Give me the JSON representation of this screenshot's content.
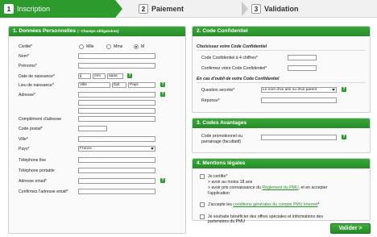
{
  "steps": [
    {
      "num": "1",
      "label": "Inscription"
    },
    {
      "num": "2",
      "label": "Paiement"
    },
    {
      "num": "3",
      "label": "Validation"
    }
  ],
  "personal": {
    "title": "1. Données Personnelles",
    "subtitle_open": "(",
    "subtitle_star": "*",
    "subtitle_text": " Champs obligatoires)",
    "civilite_label": "Civilité*",
    "civilite_options": [
      "Mlle",
      "Mme",
      "M"
    ],
    "nom_label": "Nom*",
    "prenoms_label": "Prénoms*",
    "dob_label": "Date de naissance*",
    "dob_jj": "jj",
    "dob_mm": "mm",
    "dob_aaaa": "aaaa",
    "lieu_label": "Lieu de naissance*",
    "lieu_ville": "Ville",
    "lieu_dpt": "Dpt",
    "lieu_pays": "Pays",
    "adresse_label": "Adresse*",
    "complement_label": "Complément d'adresse",
    "cp_label": "Code postal*",
    "ville_label": "Ville*",
    "pays_label": "Pays*",
    "pays_value": "France",
    "tel_fixe_label": "Téléphone fixe",
    "tel_port_label": "Téléphone portable",
    "email_label": "Adresse email*",
    "email_confirm_label": "Confirmez l'adresse email*",
    "help": "?"
  },
  "code": {
    "title": "2. Code Confidentiel",
    "choose_heading": "Choisissez votre Code Confidentiel",
    "code_label": "Code Confidentiel à 4 chiffres*",
    "confirm_label": "Confirmez votre Code Confidentiel*",
    "forget_heading": "En cas d'oubli de votre Code Confidentiel",
    "question_label": "Question secrète*",
    "question_value": "Le nom d'un ami ou d'un parent",
    "reponse_label": "Réponse*"
  },
  "advantages": {
    "title": "3. Codes Avantages",
    "promo_label_1": "Code promotionnel ou",
    "promo_label_2": "parrainage (facultatif)"
  },
  "legal": {
    "title": "4. Mentions légales",
    "certify": "Je certifie*",
    "bullet1": "> avoir au moins 18 ans",
    "bullet2_a": "> avoir pris connaissance du ",
    "bullet2_link": "Règlement du PMU",
    "bullet2_b": ", et en accepter",
    "bullet2_c": "l'application",
    "accept_a": "J'accepte les ",
    "accept_link": "conditions générales du compte PMU Internet",
    "accept_b": "*",
    "offers_1": "Je souhaite bénéficier des offres spéciales et informations des",
    "offers_2": "partenaires du PMU"
  },
  "submit_label": "Valider >"
}
